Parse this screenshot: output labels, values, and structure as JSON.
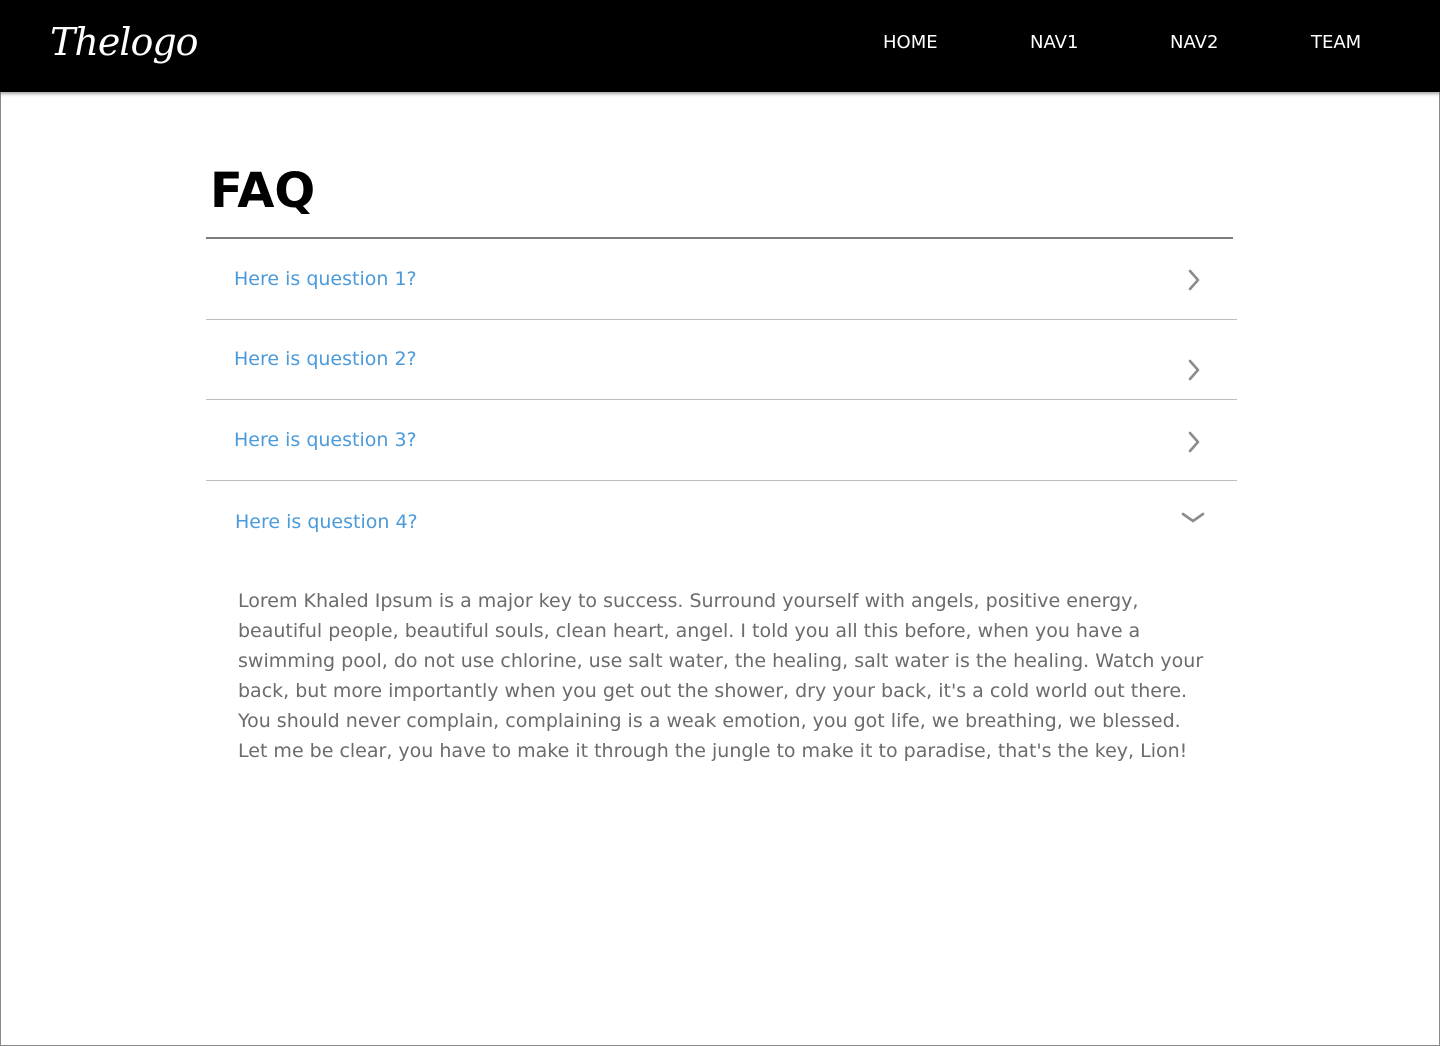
{
  "header": {
    "logo": "Thelogo",
    "nav": [
      {
        "label": "HOME"
      },
      {
        "label": "NAV1"
      },
      {
        "label": "NAV2"
      },
      {
        "label": "TEAM"
      }
    ]
  },
  "faq": {
    "title": "FAQ",
    "items": [
      {
        "question": "Here is question 1?",
        "expanded": false
      },
      {
        "question": "Here is question 2?",
        "expanded": false
      },
      {
        "question": "Here is question 3?",
        "expanded": false
      },
      {
        "question": "Here is question 4?",
        "expanded": true,
        "answer": "Lorem Khaled Ipsum is a major key to success. Surround yourself with angels, positive energy, beautiful people, beautiful souls, clean heart, angel. I told you all this before, when you have a swimming pool, do not use chlorine, use salt water, the healing, salt water is the healing. Watch your back, but more importantly when you get out the shower, dry your back, it's a cold world out there. You should never complain, complaining is a weak emotion, you got life, we breathing, we blessed. Let me be clear, you have to make it through the jungle to make it to paradise, that's the key, Lion!"
      }
    ]
  },
  "colors": {
    "navbar_bg": "#000000",
    "question_text": "#4b9ad9",
    "answer_text": "#6b6b6b",
    "chevron": "#8c8c8c"
  },
  "icons": {
    "collapsed": "chevron-right-icon",
    "expanded": "chevron-down-icon"
  }
}
